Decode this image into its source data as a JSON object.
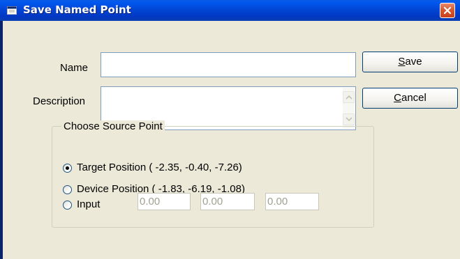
{
  "window": {
    "title": "Save Named Point",
    "title_icon": "window-app-icon",
    "close_icon": "close-icon"
  },
  "form": {
    "name_label": "Name",
    "name_value": "",
    "description_label": "Description",
    "description_value": ""
  },
  "buttons": {
    "save_mnemonic": "S",
    "save_rest": "ave",
    "cancel_mnemonic": "C",
    "cancel_rest": "ancel"
  },
  "source": {
    "group_label": "Choose Source Point",
    "selected": "target",
    "options": [
      {
        "id": "target",
        "label": "Target Position (  -2.35,  -0.40,  -7.26)"
      },
      {
        "id": "device",
        "label": "Device Position (  -1.83,  -6.19,  -1.08)"
      },
      {
        "id": "input",
        "label": "Input"
      }
    ],
    "input_values": [
      "0.00",
      "0.00",
      "0.00"
    ]
  },
  "colors": {
    "titlebar": "#0054e3",
    "dialog_bg": "#ece9d8",
    "close_button": "#d9582e"
  }
}
